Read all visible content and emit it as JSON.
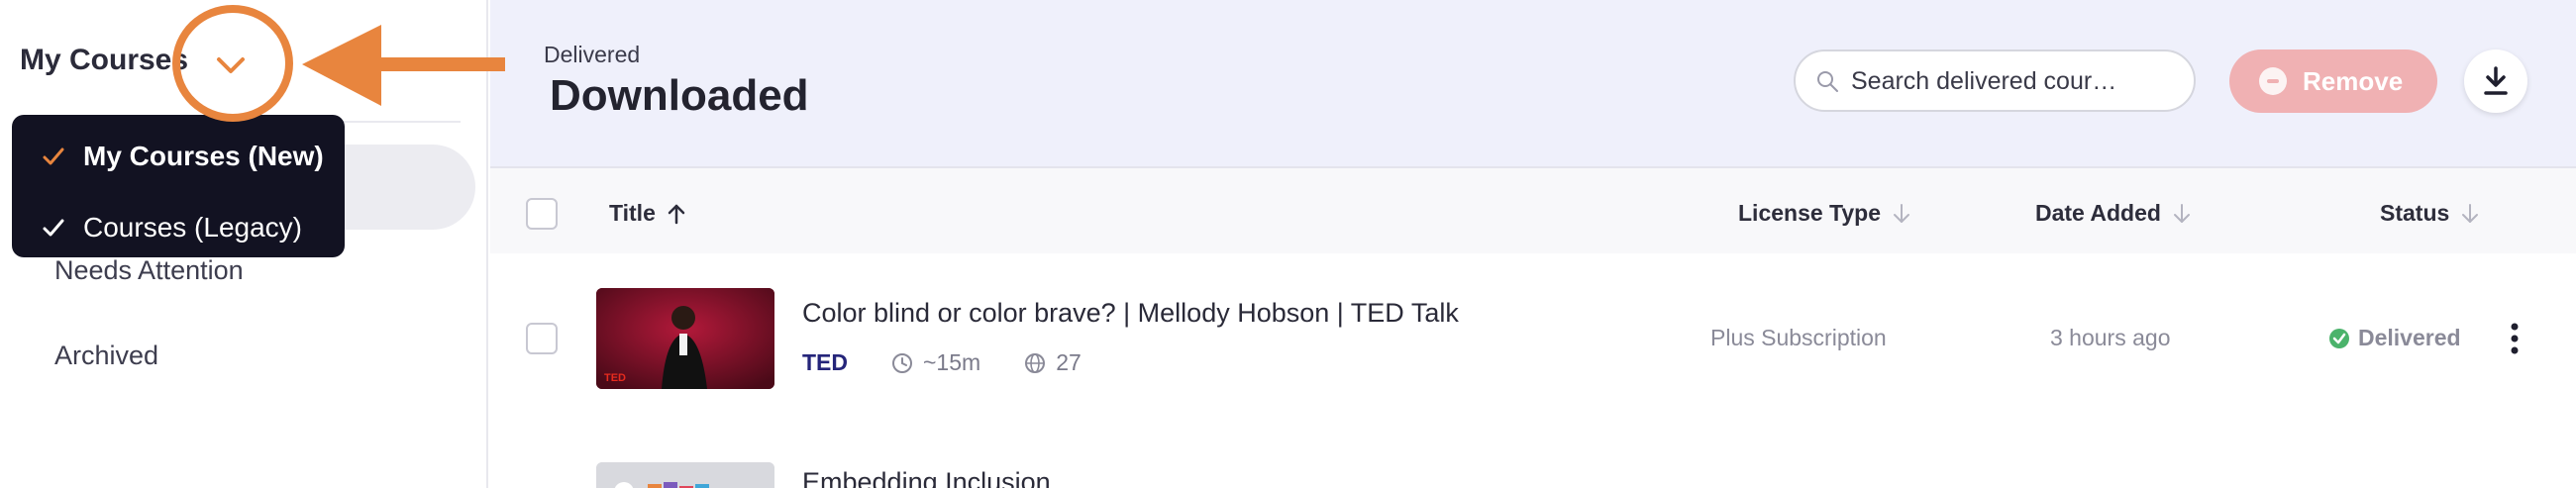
{
  "sidebar": {
    "title": "My Courses",
    "items": [
      {
        "label": "Needs Attention"
      },
      {
        "label": "Archived"
      }
    ]
  },
  "dropdown": {
    "options": [
      {
        "label": "My Courses (New)",
        "selected": true
      },
      {
        "label": "Courses (Legacy)",
        "selected": false
      }
    ]
  },
  "header": {
    "subtitle": "Delivered",
    "title": "Downloaded",
    "search_placeholder": "Search delivered cour…",
    "remove_label": "Remove"
  },
  "table": {
    "columns": {
      "title": "Title",
      "license": "License Type",
      "date": "Date Added",
      "status": "Status"
    },
    "rows": [
      {
        "title": "Color blind or color brave? | Mellody Hobson | TED Talk",
        "provider": "TED",
        "duration": "~15m",
        "languages": "27",
        "license": "Plus Subscription",
        "date_added": "3 hours ago",
        "status": "Delivered"
      },
      {
        "title": "Embedding Inclusion"
      }
    ]
  },
  "colors": {
    "annotation": "#e8853e",
    "dropdown_bg": "#121222",
    "header_bg": "#eff0fb",
    "remove_button": "#f0b1b3",
    "provider": "#25257a",
    "status_ok": "#4bb36b"
  },
  "icons": {
    "sidebar_toggle": "chevron-down-icon",
    "search": "search-icon",
    "remove": "minus-circle-icon",
    "download": "download-icon",
    "sort": "arrow-up-icon",
    "duration": "clock-icon",
    "languages": "globe-icon",
    "status": "check-circle-icon",
    "row_menu": "kebab-menu-icon"
  }
}
